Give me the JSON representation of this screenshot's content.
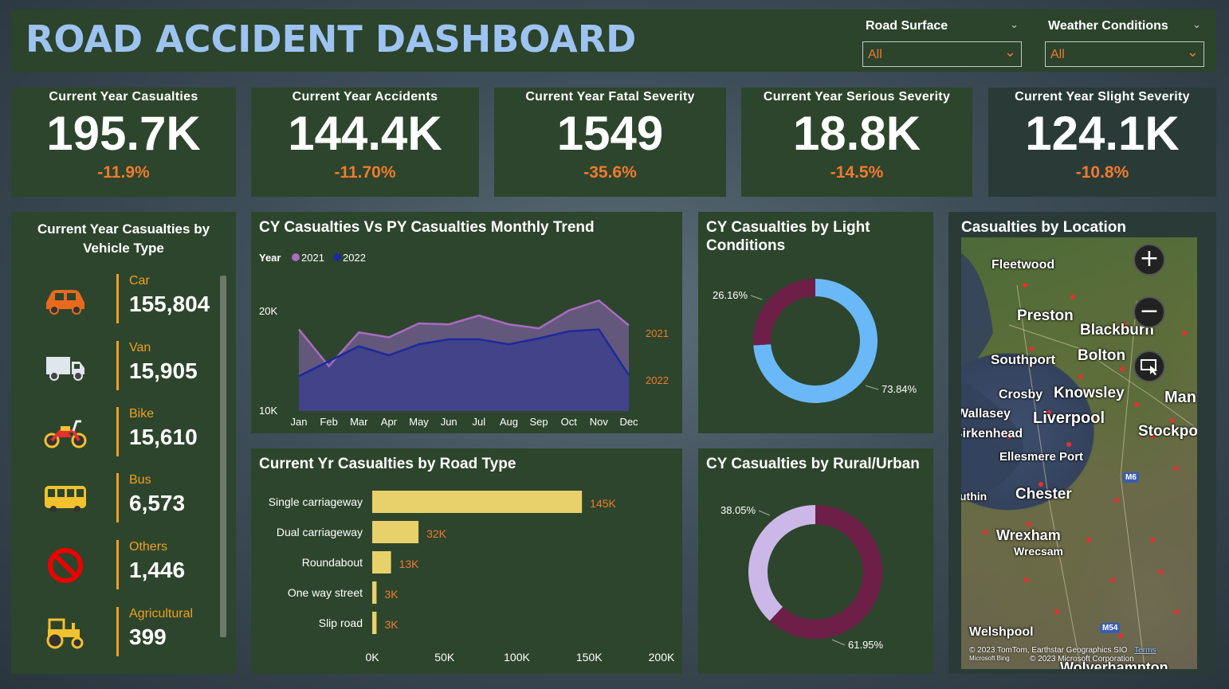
{
  "header": {
    "title": "ROAD ACCIDENT DASHBOARD",
    "slicers": [
      {
        "label": "Road Surface",
        "value": "All"
      },
      {
        "label": "Weather Conditions",
        "value": "All"
      }
    ]
  },
  "kpis": [
    {
      "title": "Current Year Casualties",
      "value": "195.7K",
      "change": "-11.9%"
    },
    {
      "title": "Current Year Accidents",
      "value": "144.4K",
      "change": "-11.70%"
    },
    {
      "title": "Current Year Fatal Severity",
      "value": "1549",
      "change": "-35.6%"
    },
    {
      "title": "Current Year Serious Severity",
      "value": "18.8K",
      "change": "-14.5%"
    },
    {
      "title": "Current Year Slight Severity",
      "value": "124.1K",
      "change": "-10.8%"
    }
  ],
  "vehicle": {
    "title": "Current Year Casualties by Vehicle Type",
    "items": [
      {
        "name": "Car",
        "value": "155,804",
        "icon": "car-icon"
      },
      {
        "name": "Van",
        "value": "15,905",
        "icon": "truck-icon"
      },
      {
        "name": "Bike",
        "value": "15,610",
        "icon": "motorbike-icon"
      },
      {
        "name": "Bus",
        "value": "6,573",
        "icon": "bus-icon"
      },
      {
        "name": "Others",
        "value": "1,446",
        "icon": "no-entry-icon"
      },
      {
        "name": "Agricultural",
        "value": "399",
        "icon": "tractor-icon"
      }
    ]
  },
  "trend": {
    "title": "CY Casualties Vs PY Casualties Monthly Trend",
    "legend_title": "Year",
    "end_labels": [
      "2021",
      "2022"
    ]
  },
  "light": {
    "title": "CY Casualties by Light Conditions",
    "labels": [
      "26.16%",
      "73.84%"
    ]
  },
  "road": {
    "title": "Current Yr Casualties by Road Type",
    "data_labels": [
      "145K",
      "32K",
      "13K",
      "3K",
      "3K"
    ]
  },
  "rural": {
    "title": "CY Casualties by Rural/Urban",
    "labels": [
      "38.05%",
      "61.95%"
    ]
  },
  "map": {
    "title": "Casualties by Location",
    "cities": [
      "Fleetwood",
      "Preston",
      "Blackburn",
      "Southport",
      "Bolton",
      "Crosby",
      "Knowsley",
      "Man",
      "Wallasey",
      "Liverpool",
      "Birkenhead",
      "Stockport",
      "Ellesmere Port",
      "M6",
      "Chester",
      "Wrexham",
      "Wrecsam",
      "Welshpool",
      "M54",
      "Wolverhampton",
      "uthin"
    ],
    "attribution": "© 2023 TomTom, Earthstar Geographics SIO",
    "attribution2": "© 2023 Microsoft Corporation",
    "terms": "Terms",
    "bing": "Microsoft Bing"
  },
  "chart_data": [
    {
      "type": "area",
      "title": "CY Casualties Vs PY Casualties Monthly Trend",
      "legend_title": "Year",
      "x": [
        "Jan",
        "Feb",
        "Mar",
        "Apr",
        "May",
        "Jun",
        "Jul",
        "Aug",
        "Sep",
        "Oct",
        "Nov",
        "Dec"
      ],
      "series": [
        {
          "name": "2021",
          "color": "#a86cc1",
          "values": [
            18200,
            14500,
            17900,
            17400,
            18800,
            18700,
            19600,
            18700,
            18300,
            20100,
            21100,
            18600
          ]
        },
        {
          "name": "2022",
          "color": "#1c2a9c",
          "values": [
            13500,
            15000,
            16500,
            15600,
            16700,
            17200,
            17200,
            16700,
            17300,
            18000,
            18200,
            13600
          ]
        }
      ],
      "y_ticks": [
        "10K",
        "20K"
      ],
      "ylim": [
        10000,
        22000
      ],
      "legend_position": "top-left"
    },
    {
      "type": "pie",
      "title": "CY Casualties by Light Conditions",
      "slices": [
        {
          "value": 26.16,
          "color": "#6e1f48"
        },
        {
          "value": 73.84,
          "color": "#6ab8f7"
        }
      ]
    },
    {
      "type": "bar",
      "orientation": "horizontal",
      "title": "Current Yr Casualties by Road Type",
      "categories": [
        "Single carriageway",
        "Dual carriageway",
        "Roundabout",
        "One way street",
        "Slip road"
      ],
      "values": [
        145000,
        32000,
        13000,
        3000,
        3000
      ],
      "x_ticks": [
        "0K",
        "50K",
        "100K",
        "150K",
        "200K"
      ],
      "xlim": [
        0,
        200000
      ],
      "color": "#e8d16b"
    },
    {
      "type": "pie",
      "title": "CY Casualties by Rural/Urban",
      "slices": [
        {
          "value": 61.95,
          "color": "#6e1f48"
        },
        {
          "value": 38.05,
          "color": "#cbb8e8"
        }
      ]
    }
  ]
}
